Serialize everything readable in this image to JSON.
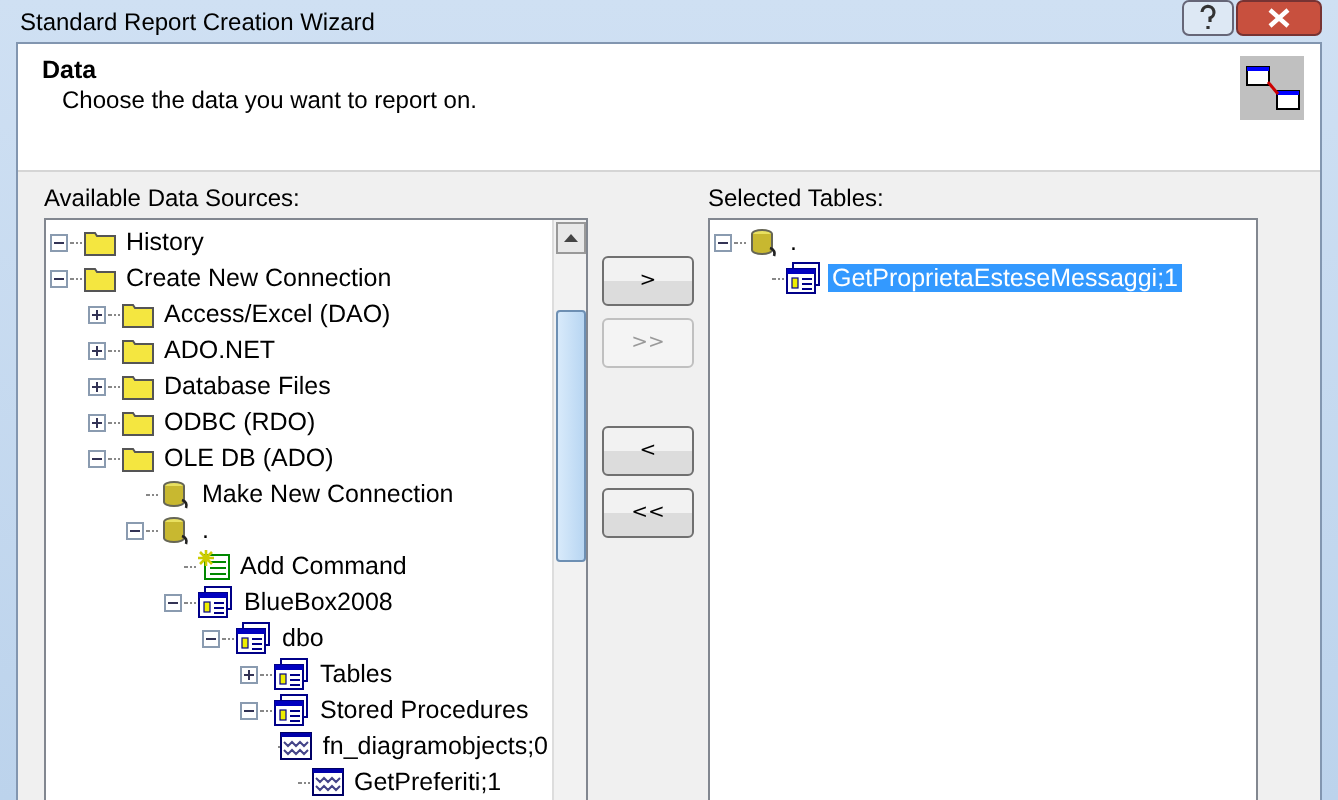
{
  "window": {
    "title": "Standard Report Creation Wizard"
  },
  "header": {
    "title": "Data",
    "subtitle": "Choose the data you want to report on."
  },
  "sources": {
    "label": "Available Data Sources:",
    "items": [
      {
        "kind": "folder",
        "label": "History",
        "expanded": true,
        "selected": false
      },
      {
        "kind": "folder",
        "label": "Create New Connection",
        "expanded": true,
        "selected": false,
        "children": [
          {
            "kind": "folder",
            "label": "Access/Excel (DAO)",
            "expanded": false,
            "selected": false
          },
          {
            "kind": "folder",
            "label": "ADO.NET",
            "expanded": false,
            "selected": false
          },
          {
            "kind": "folder",
            "label": "Database Files",
            "expanded": false,
            "selected": false
          },
          {
            "kind": "folder",
            "label": "ODBC (RDO)",
            "expanded": false,
            "selected": false
          },
          {
            "kind": "folder",
            "label": "OLE DB (ADO)",
            "expanded": true,
            "selected": false,
            "children": [
              {
                "kind": "database",
                "label": "Make New Connection",
                "selected": false
              },
              {
                "kind": "database",
                "label": ".",
                "expanded": true,
                "selected": false,
                "children": [
                  {
                    "kind": "command",
                    "label": "Add Command",
                    "selected": false
                  },
                  {
                    "kind": "container",
                    "label": "BlueBox2008",
                    "expanded": true,
                    "selected": false,
                    "children": [
                      {
                        "kind": "container",
                        "label": "dbo",
                        "expanded": true,
                        "selected": false,
                        "children": [
                          {
                            "kind": "container",
                            "label": "Tables",
                            "expanded": false,
                            "selected": false
                          },
                          {
                            "kind": "container",
                            "label": "Stored Procedures",
                            "expanded": true,
                            "selected": false,
                            "children": [
                              {
                                "kind": "procedure",
                                "label": "fn_diagramobjects;0",
                                "selected": false
                              },
                              {
                                "kind": "procedure",
                                "label": "GetPreferiti;1",
                                "selected": false
                              }
                            ]
                          }
                        ]
                      }
                    ]
                  }
                ]
              }
            ]
          }
        ]
      }
    ]
  },
  "buttons": [
    {
      "label": ">",
      "disabled": false
    },
    {
      "label": ">>",
      "disabled": true
    },
    {
      "label": "<",
      "disabled": false
    },
    {
      "label": "<<",
      "disabled": false
    }
  ],
  "selected_tables": {
    "label": "Selected Tables:",
    "items": [
      {
        "kind": "database",
        "label": ".",
        "expanded": true,
        "selected": false,
        "children": [
          {
            "kind": "container",
            "label": "GetProprietaEsteseMessaggi;1",
            "selected": true
          }
        ]
      }
    ]
  }
}
